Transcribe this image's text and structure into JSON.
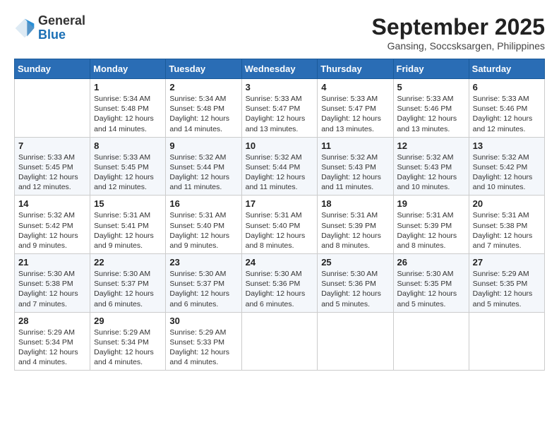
{
  "header": {
    "logo_general": "General",
    "logo_blue": "Blue",
    "month_title": "September 2025",
    "location": "Gansing, Soccsksargen, Philippines"
  },
  "calendar": {
    "days_of_week": [
      "Sunday",
      "Monday",
      "Tuesday",
      "Wednesday",
      "Thursday",
      "Friday",
      "Saturday"
    ],
    "weeks": [
      [
        {
          "day": "",
          "info": ""
        },
        {
          "day": "1",
          "info": "Sunrise: 5:34 AM\nSunset: 5:48 PM\nDaylight: 12 hours\nand 14 minutes."
        },
        {
          "day": "2",
          "info": "Sunrise: 5:34 AM\nSunset: 5:48 PM\nDaylight: 12 hours\nand 14 minutes."
        },
        {
          "day": "3",
          "info": "Sunrise: 5:33 AM\nSunset: 5:47 PM\nDaylight: 12 hours\nand 13 minutes."
        },
        {
          "day": "4",
          "info": "Sunrise: 5:33 AM\nSunset: 5:47 PM\nDaylight: 12 hours\nand 13 minutes."
        },
        {
          "day": "5",
          "info": "Sunrise: 5:33 AM\nSunset: 5:46 PM\nDaylight: 12 hours\nand 13 minutes."
        },
        {
          "day": "6",
          "info": "Sunrise: 5:33 AM\nSunset: 5:46 PM\nDaylight: 12 hours\nand 12 minutes."
        }
      ],
      [
        {
          "day": "7",
          "info": "Sunrise: 5:33 AM\nSunset: 5:45 PM\nDaylight: 12 hours\nand 12 minutes."
        },
        {
          "day": "8",
          "info": "Sunrise: 5:33 AM\nSunset: 5:45 PM\nDaylight: 12 hours\nand 12 minutes."
        },
        {
          "day": "9",
          "info": "Sunrise: 5:32 AM\nSunset: 5:44 PM\nDaylight: 12 hours\nand 11 minutes."
        },
        {
          "day": "10",
          "info": "Sunrise: 5:32 AM\nSunset: 5:44 PM\nDaylight: 12 hours\nand 11 minutes."
        },
        {
          "day": "11",
          "info": "Sunrise: 5:32 AM\nSunset: 5:43 PM\nDaylight: 12 hours\nand 11 minutes."
        },
        {
          "day": "12",
          "info": "Sunrise: 5:32 AM\nSunset: 5:43 PM\nDaylight: 12 hours\nand 10 minutes."
        },
        {
          "day": "13",
          "info": "Sunrise: 5:32 AM\nSunset: 5:42 PM\nDaylight: 12 hours\nand 10 minutes."
        }
      ],
      [
        {
          "day": "14",
          "info": "Sunrise: 5:32 AM\nSunset: 5:42 PM\nDaylight: 12 hours\nand 9 minutes."
        },
        {
          "day": "15",
          "info": "Sunrise: 5:31 AM\nSunset: 5:41 PM\nDaylight: 12 hours\nand 9 minutes."
        },
        {
          "day": "16",
          "info": "Sunrise: 5:31 AM\nSunset: 5:40 PM\nDaylight: 12 hours\nand 9 minutes."
        },
        {
          "day": "17",
          "info": "Sunrise: 5:31 AM\nSunset: 5:40 PM\nDaylight: 12 hours\nand 8 minutes."
        },
        {
          "day": "18",
          "info": "Sunrise: 5:31 AM\nSunset: 5:39 PM\nDaylight: 12 hours\nand 8 minutes."
        },
        {
          "day": "19",
          "info": "Sunrise: 5:31 AM\nSunset: 5:39 PM\nDaylight: 12 hours\nand 8 minutes."
        },
        {
          "day": "20",
          "info": "Sunrise: 5:31 AM\nSunset: 5:38 PM\nDaylight: 12 hours\nand 7 minutes."
        }
      ],
      [
        {
          "day": "21",
          "info": "Sunrise: 5:30 AM\nSunset: 5:38 PM\nDaylight: 12 hours\nand 7 minutes."
        },
        {
          "day": "22",
          "info": "Sunrise: 5:30 AM\nSunset: 5:37 PM\nDaylight: 12 hours\nand 6 minutes."
        },
        {
          "day": "23",
          "info": "Sunrise: 5:30 AM\nSunset: 5:37 PM\nDaylight: 12 hours\nand 6 minutes."
        },
        {
          "day": "24",
          "info": "Sunrise: 5:30 AM\nSunset: 5:36 PM\nDaylight: 12 hours\nand 6 minutes."
        },
        {
          "day": "25",
          "info": "Sunrise: 5:30 AM\nSunset: 5:36 PM\nDaylight: 12 hours\nand 5 minutes."
        },
        {
          "day": "26",
          "info": "Sunrise: 5:30 AM\nSunset: 5:35 PM\nDaylight: 12 hours\nand 5 minutes."
        },
        {
          "day": "27",
          "info": "Sunrise: 5:29 AM\nSunset: 5:35 PM\nDaylight: 12 hours\nand 5 minutes."
        }
      ],
      [
        {
          "day": "28",
          "info": "Sunrise: 5:29 AM\nSunset: 5:34 PM\nDaylight: 12 hours\nand 4 minutes."
        },
        {
          "day": "29",
          "info": "Sunrise: 5:29 AM\nSunset: 5:34 PM\nDaylight: 12 hours\nand 4 minutes."
        },
        {
          "day": "30",
          "info": "Sunrise: 5:29 AM\nSunset: 5:33 PM\nDaylight: 12 hours\nand 4 minutes."
        },
        {
          "day": "",
          "info": ""
        },
        {
          "day": "",
          "info": ""
        },
        {
          "day": "",
          "info": ""
        },
        {
          "day": "",
          "info": ""
        }
      ]
    ]
  }
}
